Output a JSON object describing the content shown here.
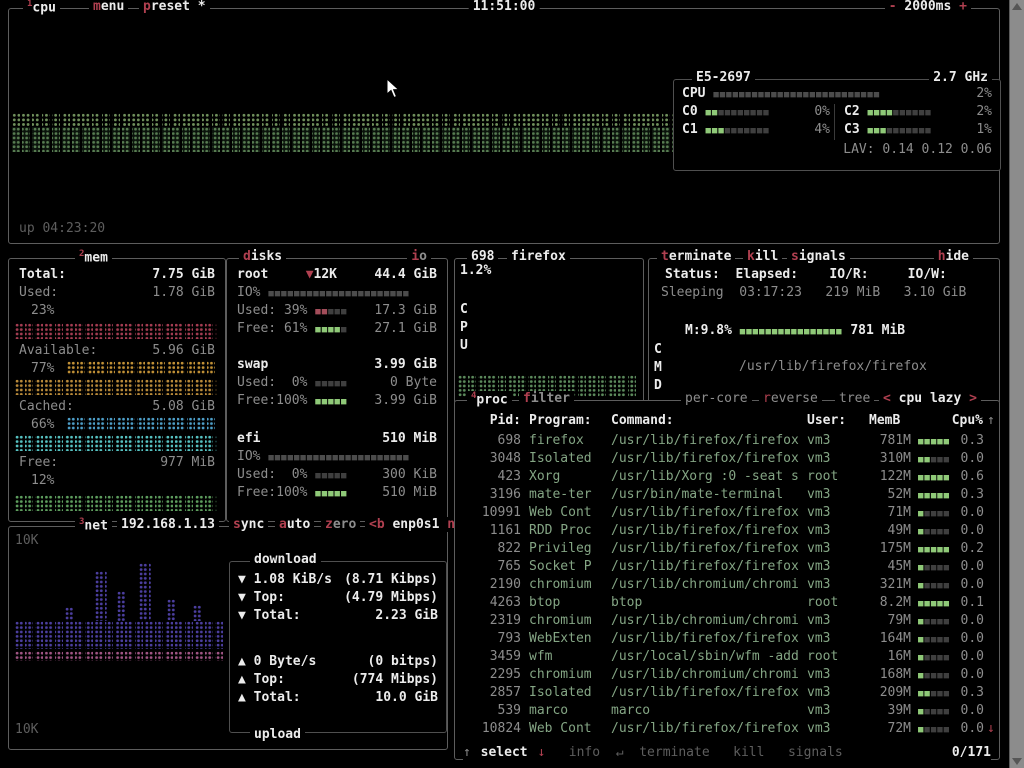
{
  "colors": {
    "background": "#000000",
    "border": "#5d5d5d",
    "title_white": "#ececec",
    "accent_red": "#b04050",
    "text_gray": "#8d8d8d",
    "proc_text_green": "#84a584",
    "meter_green": "#8fc978",
    "cpu_graph_green": "#6d8f5a",
    "mem_used_red": "#a43d52",
    "mem_available_orange": "#c29136",
    "mem_cached_blue": "#4e9fc9",
    "mem_free_green": "#5e9e5e",
    "net_download_purple": "#4c3fa0",
    "net_download_pink": "#a05584"
  },
  "topbar": {
    "box_num": "1",
    "title": "cpu",
    "menu": "menu",
    "preset": "preset *",
    "clock": "11:51:00",
    "minus": "-",
    "interval": "2000ms",
    "plus": "+"
  },
  "cpu": {
    "uptime": "up 04:23:20",
    "inner": {
      "title": "E5-2697",
      "freq": "2.7 GHz",
      "total_label": "CPU",
      "total_meter": "■■■■■■■■■■■■■■■■■■■■■■■■■■",
      "total_pct": "2%",
      "cores": [
        {
          "name": "C0",
          "m_on": "■■",
          "m_off": "■■■■■■■■",
          "pct": "0%"
        },
        {
          "name": "C1",
          "m_on": "■■■",
          "m_off": "■■■■■■■",
          "pct": "4%"
        },
        {
          "name": "C2",
          "m_on": "■■■■",
          "m_off": "■■■■■■",
          "pct": "2%"
        },
        {
          "name": "C3",
          "m_on": "■■■",
          "m_off": "■■■■■■■",
          "pct": "1%"
        }
      ],
      "lav": "LAV: 0.14 0.12 0.06"
    }
  },
  "mem": {
    "box_num": "2",
    "title": "mem",
    "total_label": "Total:",
    "total": "7.75 GiB",
    "used_label": "Used:",
    "used": "1.78 GiB",
    "used_pct": "23%",
    "available_label": "Available:",
    "available": "5.96 GiB",
    "available_pct": "77%",
    "cached_label": "Cached:",
    "cached": "5.08 GiB",
    "cached_pct": "66%",
    "free_label": "Free:",
    "free": "977 MiB",
    "free_pct": "12%"
  },
  "disks": {
    "title": "disks",
    "io_title": "io",
    "root": {
      "name": "root",
      "extra": "▼12K",
      "size": "44.4 GiB",
      "io_label": "IO%",
      "io_meter": "■■■■■■■■■■■■■■■■■■■■■■",
      "used_label": "Used:",
      "used_pct": "39%",
      "used_on": "■■",
      "used_off": "■■■",
      "used": "17.3 GiB",
      "free_label": "Free:",
      "free_pct": "61%",
      "free_on": "■■■■",
      "free_off": "■",
      "free": "27.1 GiB"
    },
    "swap": {
      "name": "swap",
      "size": "3.99 GiB",
      "used_label": "Used:",
      "used_pct": "0%",
      "used_on": "",
      "used_off": "■■■■■",
      "used": "0 Byte",
      "free_label": "Free:",
      "free_pct": "100%",
      "free_on": "■■■■■",
      "free_off": "",
      "free": "3.99 GiB"
    },
    "efi": {
      "name": "efi",
      "size": "510 MiB",
      "io_label": "IO%",
      "io_meter": "■■■■■■■■■■■■■■■■■■■■■■",
      "used_label": "Used:",
      "used_pct": "0%",
      "used_on": "",
      "used_off": "■■■■■",
      "used": "300 KiB",
      "free_label": "Free:",
      "free_pct": "100%",
      "free_on": "■■■■■",
      "free_off": "",
      "free": "510 MiB"
    }
  },
  "net": {
    "box_num": "3",
    "title": "net",
    "ip": "192.168.1.13",
    "sync": "sync",
    "auto": "auto",
    "zero": "zero",
    "iface_prev": "<b",
    "iface": "enp0s1",
    "iface_next": "n>",
    "scale_top": "10K",
    "scale_bottom": "10K",
    "download": {
      "title": "download",
      "arrow": "▼",
      "speed": "1.08 KiB/s",
      "speed_bits": "(8.71 Kibps)",
      "top_label": "Top:",
      "top": "(4.79 Mibps)",
      "total_label": "Total:",
      "total": "2.23 GiB"
    },
    "upload": {
      "title": "upload",
      "arrow": "▲",
      "speed": "0 Byte/s",
      "speed_bits": "(0 bitps)",
      "top_label": "Top:",
      "top": "(774 Mibps)",
      "total_label": "Total:",
      "total": "10.0 GiB"
    }
  },
  "detail": {
    "pid": "698",
    "name": "firefox",
    "cpu_pct": "1.2%",
    "cpu_label": "CPU",
    "terminate": "terminate",
    "kill": "kill",
    "signals": "signals",
    "hide": "hide",
    "status_label": "Status:",
    "status": "Sleeping",
    "elapsed_label": "Elapsed:",
    "elapsed": "03:17:23",
    "ior_label": "IO/R:",
    "ior": "219 MiB",
    "iow_label": "IO/W:",
    "iow": "3.10 GiB",
    "mem_label": "M:9.8%",
    "mem_meter": "■■■■■■■■■■■■■■■■",
    "mem": "781 MiB",
    "cmd_label": "CMD",
    "cmd": "/usr/lib/firefox/firefox"
  },
  "proc": {
    "box_num": "4",
    "title": "proc",
    "filter": "filter",
    "per_core": "per-core",
    "reverse": "reverse",
    "tree": "tree",
    "sort_prev": "<",
    "sort": "cpu lazy",
    "sort_next": ">",
    "columns": {
      "pid": "Pid:",
      "program": "Program:",
      "command": "Command:",
      "user": "User:",
      "mem": "MemB",
      "cpu": "Cpu%"
    },
    "scroll_up": "↑",
    "scroll_down": "↓",
    "rows": [
      {
        "pid": "698",
        "program": "firefox",
        "command": "/usr/lib/firefox/firefox",
        "user": "vm3",
        "mem": "781M",
        "m_on": "■■■■■",
        "m_off": "",
        "cpu": "0.3"
      },
      {
        "pid": "3048",
        "program": "Isolated",
        "command": "/usr/lib/firefox/firefox",
        "user": "vm3",
        "mem": "310M",
        "m_on": "■■",
        "m_off": "■■■",
        "cpu": "0.0"
      },
      {
        "pid": "423",
        "program": "Xorg",
        "command": "/usr/lib/Xorg :0 -seat s",
        "user": "root",
        "mem": "122M",
        "m_on": "■■■■■",
        "m_off": "",
        "cpu": "0.6"
      },
      {
        "pid": "3196",
        "program": "mate-ter",
        "command": "/usr/bin/mate-terminal",
        "user": "vm3",
        "mem": "52M",
        "m_on": "■■■■■",
        "m_off": "",
        "cpu": "0.3"
      },
      {
        "pid": "10991",
        "program": "Web Cont",
        "command": "/usr/lib/firefox/firefox",
        "user": "vm3",
        "mem": "71M",
        "m_on": "■",
        "m_off": "■■■■",
        "cpu": "0.0"
      },
      {
        "pid": "1161",
        "program": "RDD Proc",
        "command": "/usr/lib/firefox/firefox",
        "user": "vm3",
        "mem": "49M",
        "m_on": "■",
        "m_off": "■■■■",
        "cpu": "0.0"
      },
      {
        "pid": "822",
        "program": "Privileg",
        "command": "/usr/lib/firefox/firefox",
        "user": "vm3",
        "mem": "175M",
        "m_on": "■■■■■",
        "m_off": "",
        "cpu": "0.2"
      },
      {
        "pid": "765",
        "program": "Socket P",
        "command": "/usr/lib/firefox/firefox",
        "user": "vm3",
        "mem": "45M",
        "m_on": "■",
        "m_off": "■■■■",
        "cpu": "0.0"
      },
      {
        "pid": "2190",
        "program": "chromium",
        "command": "/usr/lib/chromium/chromi",
        "user": "vm3",
        "mem": "321M",
        "m_on": "■",
        "m_off": "■■■■",
        "cpu": "0.0"
      },
      {
        "pid": "4263",
        "program": "btop",
        "command": "btop",
        "user": "root",
        "mem": "8.2M",
        "m_on": "■■■■■",
        "m_off": "",
        "cpu": "0.1"
      },
      {
        "pid": "2319",
        "program": "chromium",
        "command": "/usr/lib/chromium/chromi",
        "user": "vm3",
        "mem": "79M",
        "m_on": "■",
        "m_off": "■■■■",
        "cpu": "0.0"
      },
      {
        "pid": "793",
        "program": "WebExten",
        "command": "/usr/lib/firefox/firefox",
        "user": "vm3",
        "mem": "164M",
        "m_on": "■",
        "m_off": "■■■■",
        "cpu": "0.0"
      },
      {
        "pid": "3459",
        "program": "wfm",
        "command": "/usr/local/sbin/wfm -add",
        "user": "root",
        "mem": "16M",
        "m_on": "■",
        "m_off": "■■■■",
        "cpu": "0.0"
      },
      {
        "pid": "2295",
        "program": "chromium",
        "command": "/usr/lib/chromium/chromi",
        "user": "vm3",
        "mem": "168M",
        "m_on": "■",
        "m_off": "■■■■",
        "cpu": "0.0"
      },
      {
        "pid": "2857",
        "program": "Isolated",
        "command": "/usr/lib/firefox/firefox",
        "user": "vm3",
        "mem": "209M",
        "m_on": "■■",
        "m_off": "■■■",
        "cpu": "0.3"
      },
      {
        "pid": "539",
        "program": "marco",
        "command": "marco",
        "user": "vm3",
        "mem": "39M",
        "m_on": "■",
        "m_off": "■■■■",
        "cpu": "0.0"
      },
      {
        "pid": "10824",
        "program": "Web Cont",
        "command": "/usr/lib/firefox/firefox",
        "user": "vm3",
        "mem": "72M",
        "m_on": "■",
        "m_off": "■■■■",
        "cpu": "0.0"
      }
    ],
    "footer": {
      "up": "↑",
      "select": "select",
      "down": "↓",
      "info": "info",
      "enter": "↵",
      "terminate": "terminate",
      "kill": "kill",
      "signals": "signals",
      "count": "0/171"
    }
  }
}
